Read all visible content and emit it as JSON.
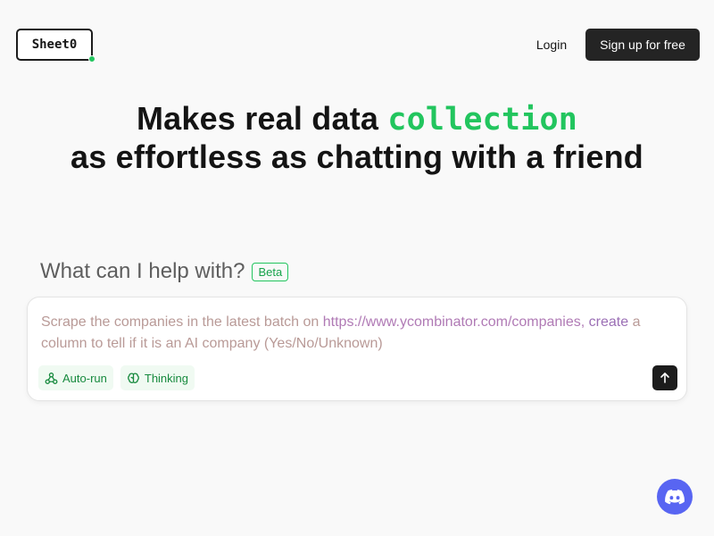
{
  "header": {
    "logo_text": "Sheet0",
    "login_label": "Login",
    "signup_label": "Sign up for free"
  },
  "hero": {
    "line1_prefix": "Makes real data ",
    "line1_accent": "collection",
    "line2": "as effortless as chatting with a friend"
  },
  "prompt": {
    "title": "What can I help with?",
    "badge": "Beta",
    "placeholder_start": "Scrape the companies in the latest batch on ",
    "placeholder_url": "https://www.ycombinator.com/companies, ",
    "placeholder_end_1": "create",
    "placeholder_end_2": " a column to tell if it is an AI company (Yes/No/Unknown)",
    "chips": [
      {
        "label": "Auto-run",
        "icon": "auto-run-icon"
      },
      {
        "label": "Thinking",
        "icon": "brain-icon"
      }
    ]
  },
  "colors": {
    "accent": "#22c55e",
    "dark_button": "#242424",
    "discord": "#5865f2"
  }
}
